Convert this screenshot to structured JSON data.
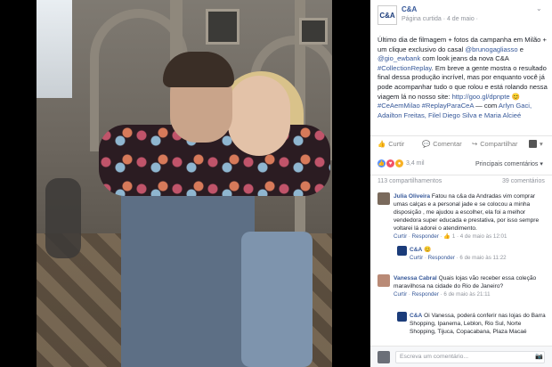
{
  "post": {
    "page_name": "C&A",
    "meta": "Página curtida · 4 de maio ·",
    "text_parts": [
      "Último dia de filmagem + fotos da campanha em Milão + um clique exclusivo do casal ",
      "@brunogagliasso",
      " e ",
      "@gio_ewbank",
      " com look jeans da nova C&A ",
      "#CollectionReplay",
      ". Em breve a gente mostra o resultado final dessa produção incrível, mas por enquanto você já pode acompanhar tudo o que rolou e está rolando nessa viagem lá no nosso site: ",
      "http://goo.gl/dpnpte",
      " 😊 ",
      "#CeAemMilao #ReplayParaCeA",
      " — com ",
      "Arlyn Gaci, Adailton Freitas, Filel Diego Silva e Maria Alcieé"
    ]
  },
  "actions": {
    "like": "Curtir",
    "comment": "Comentar",
    "share": "Compartilhar"
  },
  "reactions": {
    "count": "3,4 mil",
    "relevant": "Principais comentários ▾"
  },
  "shares": {
    "count": "113 compartilhamentos",
    "comments": "39 comentários"
  },
  "comments": [
    {
      "author": "Julia Oliveira",
      "text": "Fatou na c&a da Andradas vim comprar umas calças e a personal jade e se colocou a minha disposição , me ajudou a escolher, ela foi a melhor vendedora super educada e prestativa, por isso sempre voltarei lá adorei o atendimento.",
      "meta_like": "Curtir",
      "meta_reply": "Responder",
      "meta_rest": " · 👍 1 · 4 de maio às 12:01"
    },
    {
      "author": "C&A",
      "text": "😊",
      "meta_like": "Curtir",
      "meta_reply": "Responder",
      "meta_rest": " · 6 de maio às 11:22",
      "is_reply": true
    },
    {
      "author": "Vanessa Cabral",
      "text": "Quais lojas vão receber essa coleção maravilhosa na cidade do Rio de Janeiro?",
      "meta_like": "Curtir",
      "meta_reply": "Responder",
      "meta_rest": " · 6 de maio às 21:11"
    },
    {
      "author": "C&A",
      "text": "Oi Vanessa, poderá conferir nas lojas do Barra Shopping, Ipanema, Leblon, Rio Sul, Norte Shopping, Tijuca, Copacabana, Plaza Macaé",
      "meta_like": "",
      "meta_reply": "",
      "meta_rest": "",
      "is_reply": true
    }
  ],
  "write": {
    "placeholder": "Escreva um comentário..."
  }
}
